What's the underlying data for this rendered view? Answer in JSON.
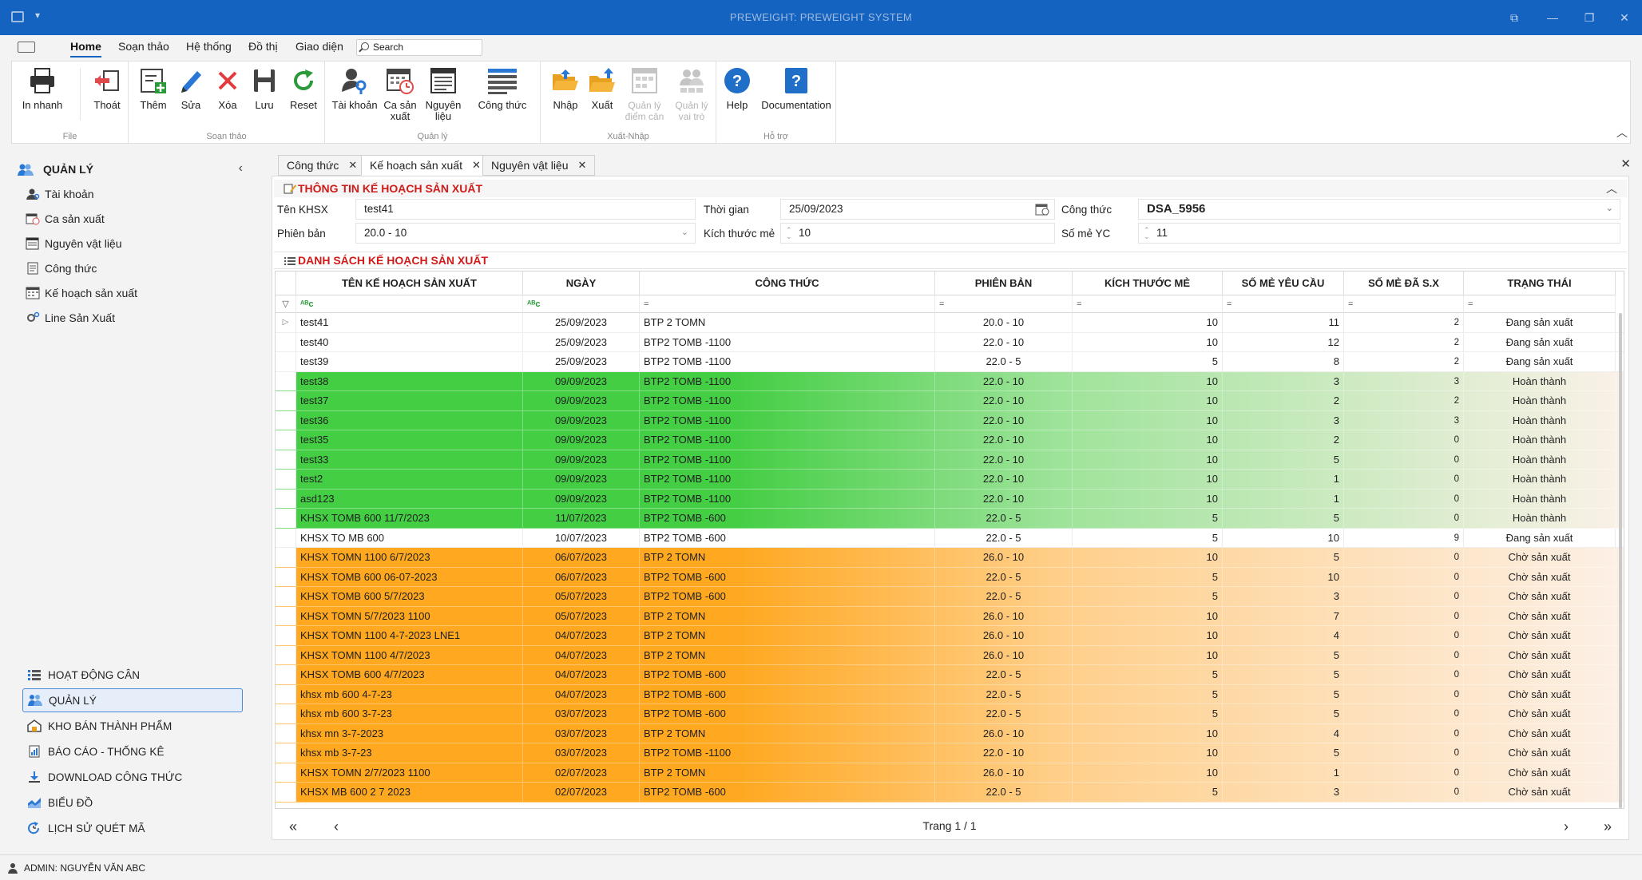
{
  "window": {
    "title": "PREWEIGHT: PREWEIGHT SYSTEM"
  },
  "ribbon": {
    "tabs": [
      "Home",
      "Soạn thảo",
      "Hệ thống",
      "Đồ thị",
      "Giao diện"
    ],
    "search_placeholder": "Search",
    "groups": {
      "file": "File",
      "soan_thao": "Soạn thảo",
      "quan_ly": "Quản lý",
      "xuat_nhap": "Xuất-Nhập",
      "ho_tro": "Hỗ trợ"
    },
    "buttons": {
      "in_nhanh": "In nhanh",
      "thoat": "Thoát",
      "them": "Thêm",
      "sua": "Sửa",
      "xoa": "Xóa",
      "luu": "Lưu",
      "reset": "Reset",
      "tai_khoan": "Tài khoản",
      "ca_san_xuat_1": "Ca sản",
      "ca_san_xuat_2": "xuất",
      "nguyen_lieu_1": "Nguyên",
      "nguyen_lieu_2": "liệu",
      "cong_thuc": "Công thức",
      "nhap": "Nhập",
      "xuat": "Xuất",
      "ql_diem_can_1": "Quản lý",
      "ql_diem_can_2": "điểm cân",
      "ql_vai_tro_1": "Quản lý",
      "ql_vai_tro_2": "vai trò",
      "help": "Help",
      "documentation": "Documentation"
    }
  },
  "sidebar": {
    "header": "QUẢN LÝ",
    "items": [
      "Tài khoản",
      "Ca sản xuất",
      "Nguyên vật liệu",
      "Công thức",
      "Kế hoạch sản xuất",
      "Line Sản Xuất"
    ],
    "bottom_items": [
      "HOẠT ĐỘNG CÂN",
      "QUẢN LÝ",
      "KHO BÁN THÀNH PHẨM",
      "BÁO CÁO - THỐNG KÊ",
      "DOWNLOAD CÔNG THỨC",
      "BIỂU ĐỒ",
      "LỊCH SỬ QUÉT MÃ"
    ]
  },
  "doc_tabs": [
    "Công thức",
    "Kế hoạch sản xuất",
    "Nguyên vật liệu"
  ],
  "info": {
    "title": "THÔNG TIN KẾ HOẠCH SẢN XUẤT",
    "ten_khsx_label": "Tên KHSX",
    "ten_khsx_value": "test41",
    "thoi_gian_label": "Thời gian",
    "thoi_gian_value": "25/09/2023",
    "cong_thuc_label": "Công thức",
    "cong_thuc_value": "DSA_5956",
    "phien_ban_label": "Phiên bản",
    "phien_ban_value": "20.0 - 10",
    "kich_thuoc_label": "Kích thước mẻ",
    "kich_thuoc_value": "10",
    "so_me_label": "Số mẻ YC",
    "so_me_value": "11"
  },
  "list": {
    "title": "DANH SÁCH KẾ HOẠCH SẢN XUẤT",
    "columns": [
      "TÊN KẾ HOẠCH SẢN XUẤT",
      "NGÀY",
      "CÔNG THỨC",
      "PHIÊN BẢN",
      "KÍCH THƯỚC MẺ",
      "SỐ MẺ YÊU CẦU",
      "SỐ MẺ ĐÃ S.X",
      "TRẠNG THÁI"
    ],
    "rows": [
      [
        "test41",
        "25/09/2023",
        "BTP 2 TOMN",
        "20.0 - 10",
        "10",
        "11",
        "2",
        "Đang sản xuất"
      ],
      [
        "test40",
        "25/09/2023",
        "BTP2 TOMB -1100",
        "22.0 - 10",
        "10",
        "12",
        "2",
        "Đang sản xuất"
      ],
      [
        "test39",
        "25/09/2023",
        "BTP2 TOMB -1100",
        "22.0 - 5",
        "5",
        "8",
        "2",
        "Đang sản xuất"
      ],
      [
        "test38",
        "09/09/2023",
        "BTP2 TOMB -1100",
        "22.0 - 10",
        "10",
        "3",
        "3",
        "Hoàn thành"
      ],
      [
        "test37",
        "09/09/2023",
        "BTP2 TOMB -1100",
        "22.0 - 10",
        "10",
        "2",
        "2",
        "Hoàn thành"
      ],
      [
        "test36",
        "09/09/2023",
        "BTP2 TOMB -1100",
        "22.0 - 10",
        "10",
        "3",
        "3",
        "Hoàn thành"
      ],
      [
        "test35",
        "09/09/2023",
        "BTP2 TOMB -1100",
        "22.0 - 10",
        "10",
        "2",
        "0",
        "Hoàn thành"
      ],
      [
        "test33",
        "09/09/2023",
        "BTP2 TOMB -1100",
        "22.0 - 10",
        "10",
        "5",
        "0",
        "Hoàn thành"
      ],
      [
        "test2",
        "09/09/2023",
        "BTP2 TOMB -1100",
        "22.0 - 10",
        "10",
        "1",
        "0",
        "Hoàn thành"
      ],
      [
        "asd123",
        "09/09/2023",
        "BTP2 TOMB -1100",
        "22.0 - 10",
        "10",
        "1",
        "0",
        "Hoàn thành"
      ],
      [
        "KHSX TOMB 600 11/7/2023",
        "11/07/2023",
        "BTP2 TOMB -600",
        "22.0 - 5",
        "5",
        "5",
        "0",
        "Hoàn thành"
      ],
      [
        "KHSX TO MB 600",
        "10/07/2023",
        "BTP2 TOMB -600",
        "22.0 - 5",
        "5",
        "10",
        "9",
        "Đang sản xuất"
      ],
      [
        "KHSX TOMN 1100 6/7/2023",
        "06/07/2023",
        "BTP 2 TOMN",
        "26.0 - 10",
        "10",
        "5",
        "0",
        "Chờ sản xuất"
      ],
      [
        "KHSX TOMB 600 06-07-2023",
        "06/07/2023",
        "BTP2 TOMB -600",
        "22.0 - 5",
        "5",
        "10",
        "0",
        "Chờ sản xuất"
      ],
      [
        "KHSX TOMB 600 5/7/2023",
        "05/07/2023",
        "BTP2 TOMB -600",
        "22.0 - 5",
        "5",
        "3",
        "0",
        "Chờ sản xuất"
      ],
      [
        "KHSX TOMN 5/7/2023 1100",
        "05/07/2023",
        "BTP 2 TOMN",
        "26.0 - 10",
        "10",
        "7",
        "0",
        "Chờ sản xuất"
      ],
      [
        "KHSX TOMN 1100 4-7-2023 LNE1",
        "04/07/2023",
        "BTP 2 TOMN",
        "26.0 - 10",
        "10",
        "4",
        "0",
        "Chờ sản xuất"
      ],
      [
        "KHSX TOMN 1100 4/7/2023",
        "04/07/2023",
        "BTP 2 TOMN",
        "26.0 - 10",
        "10",
        "5",
        "0",
        "Chờ sản xuất"
      ],
      [
        "KHSX TOMB 600 4/7/2023",
        "04/07/2023",
        "BTP2 TOMB -600",
        "22.0 - 5",
        "5",
        "5",
        "0",
        "Chờ sản xuất"
      ],
      [
        "khsx mb 600 4-7-23",
        "04/07/2023",
        "BTP2 TOMB -600",
        "22.0 - 5",
        "5",
        "5",
        "0",
        "Chờ sản xuất"
      ],
      [
        "khsx mb 600 3-7-23",
        "03/07/2023",
        "BTP2 TOMB -600",
        "22.0 - 5",
        "5",
        "5",
        "0",
        "Chờ sản xuất"
      ],
      [
        "khsx mn 3-7-2023",
        "03/07/2023",
        "BTP 2 TOMN",
        "26.0 - 10",
        "10",
        "4",
        "0",
        "Chờ sản xuất"
      ],
      [
        "khsx mb 3-7-23",
        "03/07/2023",
        "BTP2 TOMB -1100",
        "22.0 - 10",
        "10",
        "5",
        "0",
        "Chờ sản xuất"
      ],
      [
        "KHSX TOMN 2/7/2023 1100",
        "02/07/2023",
        "BTP 2 TOMN",
        "26.0 - 10",
        "10",
        "1",
        "0",
        "Chờ sản xuất"
      ],
      [
        "KHSX MB 600 2 7 2023",
        "02/07/2023",
        "BTP2 TOMB -600",
        "22.0 - 5",
        "5",
        "3",
        "0",
        "Chờ sản xuất"
      ]
    ]
  },
  "pager": {
    "text": "Trang 1 / 1"
  },
  "status": {
    "user": "ADMIN: NGUYỄN VĂN ABC"
  },
  "colors": {
    "titlebar": "#1563c0",
    "status_done_left": "#44ce44",
    "status_done_right": "#fbf1e8",
    "status_wait_left": "#ffa820",
    "status_wait_right": "#fcf0e6",
    "section_title": "#d11a1a"
  },
  "icons": {
    "ribbon": [
      "printer-icon",
      "exit-icon",
      "add-icon",
      "edit-icon",
      "delete-icon",
      "save-icon",
      "reset-icon",
      "user-key-icon",
      "calendar-clock-icon",
      "book-icon",
      "list-icon",
      "folder-open-icon",
      "folder-upload-icon",
      "scale-grid-icon",
      "users-grid-icon",
      "help-icon",
      "documentation-icon"
    ]
  }
}
